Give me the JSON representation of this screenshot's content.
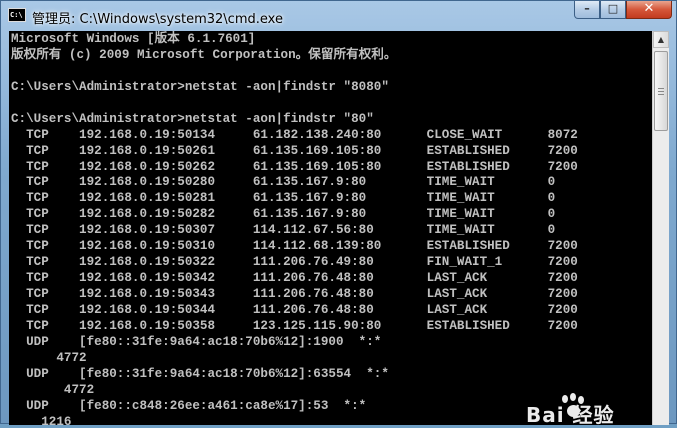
{
  "window": {
    "title": "管理员: C:\\Windows\\system32\\cmd.exe",
    "icon_label": "C:\\",
    "controls": {
      "minimize": "–",
      "maximize": "□",
      "close": "✕"
    }
  },
  "console": {
    "lines": [
      "Microsoft Windows [版本 6.1.7601]",
      "版权所有 (c) 2009 Microsoft Corporation。保留所有权利。",
      "",
      "C:\\Users\\Administrator>netstat -aon|findstr \"8080\"",
      "",
      "C:\\Users\\Administrator>netstat -aon|findstr \"80\"",
      "  TCP    192.168.0.19:50134     61.182.138.240:80      CLOSE_WAIT      8072",
      "  TCP    192.168.0.19:50261     61.135.169.105:80      ESTABLISHED     7200",
      "  TCP    192.168.0.19:50262     61.135.169.105:80      ESTABLISHED     7200",
      "  TCP    192.168.0.19:50280     61.135.167.9:80        TIME_WAIT       0",
      "  TCP    192.168.0.19:50281     61.135.167.9:80        TIME_WAIT       0",
      "  TCP    192.168.0.19:50282     61.135.167.9:80        TIME_WAIT       0",
      "  TCP    192.168.0.19:50307     114.112.67.56:80       TIME_WAIT       0",
      "  TCP    192.168.0.19:50310     114.112.68.139:80      ESTABLISHED     7200",
      "  TCP    192.168.0.19:50322     111.206.76.49:80       FIN_WAIT_1      7200",
      "  TCP    192.168.0.19:50342     111.206.76.48:80       LAST_ACK        7200",
      "  TCP    192.168.0.19:50343     111.206.76.48:80       LAST_ACK        7200",
      "  TCP    192.168.0.19:50344     111.206.76.48:80       LAST_ACK        7200",
      "  TCP    192.168.0.19:50358     123.125.115.90:80      ESTABLISHED     7200",
      "  UDP    [fe80::31fe:9a64:ac18:70b6%12]:1900  *:*",
      "      4772",
      "  UDP    [fe80::31fe:9a64:ac18:70b6%12]:63554  *:*",
      "       4772",
      "  UDP    [fe80::c848:26ee:a461:ca8e%17]:53  *:*",
      "    1216"
    ]
  },
  "scrollbar": {
    "up_arrow": "▲"
  },
  "watermark": {
    "text": "Bai 经验"
  }
}
